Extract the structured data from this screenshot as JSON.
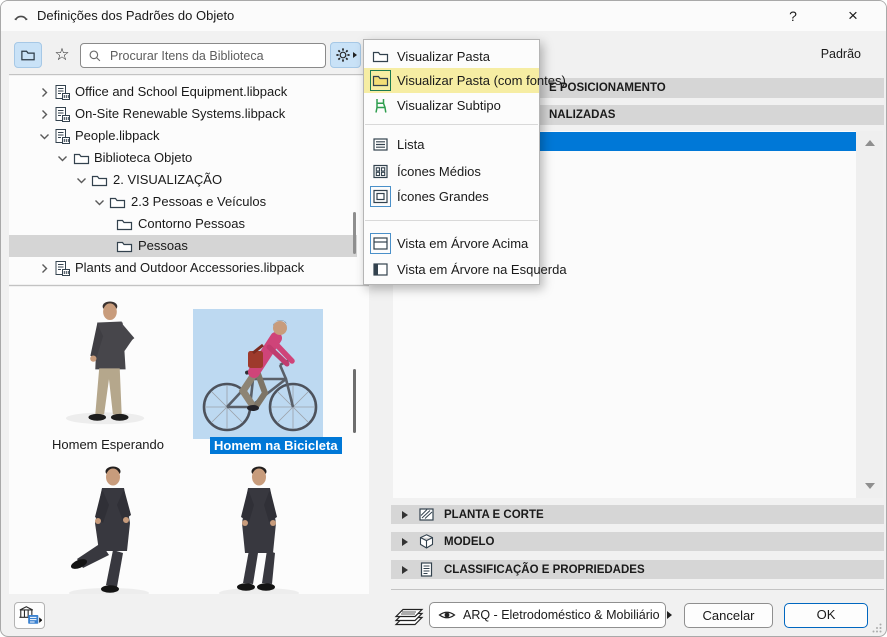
{
  "window": {
    "title": "Definições dos Padrões do Objeto",
    "help_label": "?",
    "close_label": "×"
  },
  "toolbar": {
    "search_placeholder": "Procurar Itens da Biblioteca"
  },
  "library_tree": {
    "items": [
      {
        "label": "Office and School Equipment.libpack",
        "icon": "libpack-icon",
        "state": "collapsed"
      },
      {
        "label": "On-Site Renewable Systems.libpack",
        "icon": "libpack-icon",
        "state": "collapsed"
      },
      {
        "label": "People.libpack",
        "icon": "libpack-icon",
        "state": "expanded"
      },
      {
        "label": "Biblioteca Objeto",
        "icon": "folder-icon",
        "state": "expanded"
      },
      {
        "label": "2. VISUALIZAÇÃO",
        "icon": "folder-icon",
        "state": "expanded"
      },
      {
        "label": "2.3 Pessoas e Veículos",
        "icon": "folder-icon",
        "state": "expanded"
      },
      {
        "label": "Contorno Pessoas",
        "icon": "folder-icon",
        "state": "leaf"
      },
      {
        "label": "Pessoas",
        "icon": "folder-icon",
        "state": "leaf",
        "selected": true
      },
      {
        "label": "Plants and Outdoor Accessories.libpack",
        "icon": "libpack-icon",
        "state": "collapsed"
      }
    ]
  },
  "view_menu": {
    "items": [
      {
        "label": "Visualizar Pasta",
        "icon": "folder-icon"
      },
      {
        "label": "Visualizar Pasta (com fontes)",
        "icon": "folder-sources-icon",
        "highlighted": true
      },
      {
        "label": "Visualizar Subtipo",
        "icon": "chair-icon"
      },
      {
        "label": "Lista",
        "icon": "list-view-icon"
      },
      {
        "label": "Ícones Médios",
        "icon": "medium-icons-icon"
      },
      {
        "label": "Ícones Grandes",
        "icon": "large-icons-icon",
        "checked": true
      },
      {
        "label": "Vista em Árvore Acima",
        "icon": "tree-above-icon",
        "checked": true
      },
      {
        "label": "Vista em Árvore na Esquerda",
        "icon": "tree-left-icon"
      }
    ]
  },
  "object_browser": {
    "items": [
      {
        "label": "Homem Esperando",
        "selected": false
      },
      {
        "label": "Homem na Bicicleta",
        "selected": true
      }
    ]
  },
  "settings_panel": {
    "default_label": "Padrão",
    "top_sections_visible_text": [
      "E POSICIONAMENTO",
      "NALIZADAS"
    ],
    "sections": [
      {
        "label": "PLANTA E CORTE",
        "icon": "plan-section-icon"
      },
      {
        "label": "MODELO",
        "icon": "cube-icon"
      },
      {
        "label": "CLASSIFICAÇÃO E PROPRIEDADES",
        "icon": "properties-doc-icon"
      }
    ]
  },
  "footer": {
    "layer_selector_value": "ARQ - Eletrodoméstico & Mobiliário",
    "cancel_label": "Cancelar",
    "ok_label": "OK"
  },
  "colors": {
    "accent_blue": "#0078d7",
    "menu_highlight_yellow": "#f6eda3",
    "selected_thumb_blue": "#bdd9f1",
    "toolbar_toggle_blue": "#c9e2f7",
    "panel_header_gray": "#d6d6d6",
    "tree_selection_gray": "#d5d5d5",
    "ok_border_blue": "#0067c0",
    "subtype_icon_green": "#2f9e4e"
  }
}
